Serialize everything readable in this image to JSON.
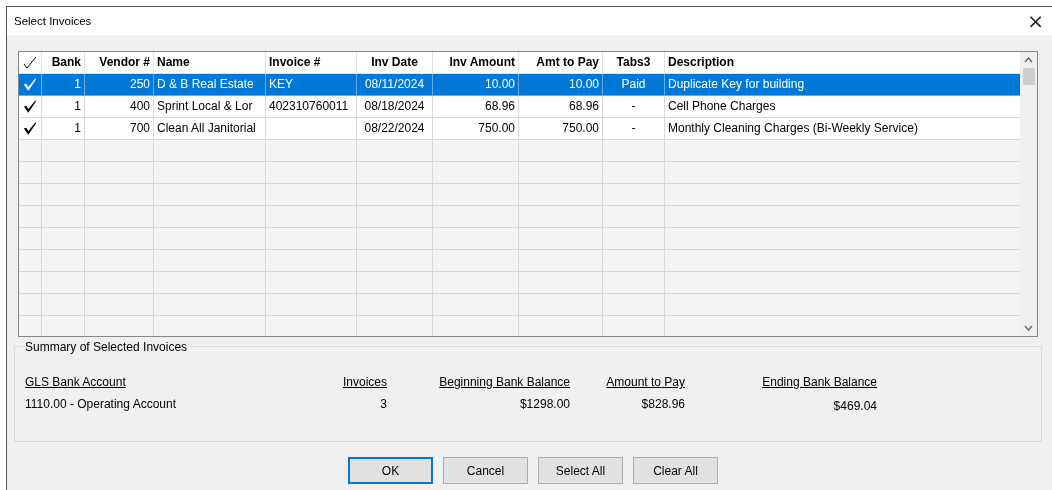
{
  "window": {
    "title": "Select Invoices",
    "close": "×"
  },
  "table": {
    "columns": [
      "Bank",
      "Vendor #",
      "Name",
      "Invoice #",
      "Inv Date",
      "Inv Amount",
      "Amt to Pay",
      "Tabs3",
      "Description"
    ],
    "rows": [
      {
        "checked": true,
        "selected": true,
        "cells": [
          "1",
          "250",
          "D & B Real Estate",
          "KEY",
          "08/11/2024",
          "10.00",
          "10.00",
          "Paid",
          "Duplicate Key for building"
        ]
      },
      {
        "checked": true,
        "selected": false,
        "cells": [
          "1",
          "400",
          "Sprint Local & Lor",
          "402310760011",
          "08/18/2024",
          "68.96",
          "68.96",
          "-",
          "Cell Phone Charges"
        ]
      },
      {
        "checked": true,
        "selected": false,
        "cells": [
          "1",
          "700",
          "Clean All Janitorial",
          "",
          "08/22/2024",
          "750.00",
          "750.00",
          "-",
          "Monthly Cleaning Charges (Bi-Weekly Service)"
        ]
      }
    ]
  },
  "summary": {
    "title": "Summary of Selected Invoices",
    "headings": [
      "GLS Bank Account",
      "Invoices",
      "Beginning Bank Balance",
      "Amount to Pay",
      "Ending Bank Balance"
    ],
    "values": [
      "1110.00 - Operating Account",
      "3",
      "$1298.00",
      "$828.96",
      "$469.04"
    ]
  },
  "buttons": [
    {
      "label": "OK",
      "default": true
    },
    {
      "label": "Cancel",
      "default": false
    },
    {
      "label": "Select All",
      "default": false
    },
    {
      "label": "Clear All",
      "default": false
    }
  ]
}
